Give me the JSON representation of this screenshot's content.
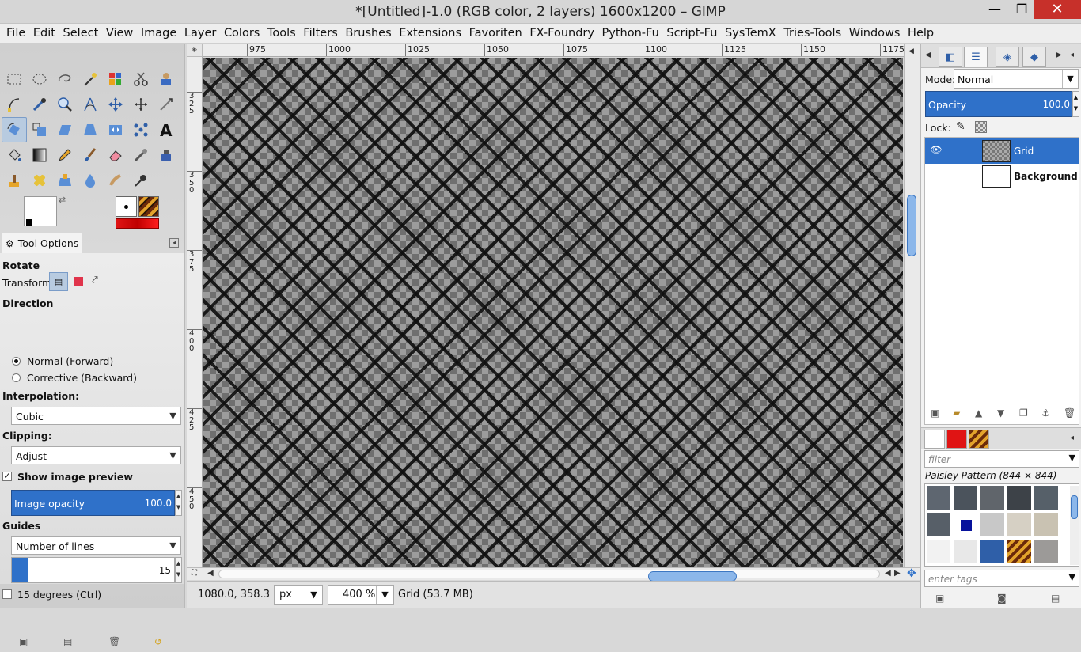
{
  "window": {
    "title": "*[Untitled]-1.0 (RGB color, 2 layers) 1600x1200 – GIMP",
    "minimize": "—",
    "maximize": "❐",
    "close": "✕"
  },
  "menu": [
    "File",
    "Edit",
    "Select",
    "View",
    "Image",
    "Layer",
    "Colors",
    "Tools",
    "Filters",
    "Brushes",
    "Extensions",
    "Favoriten",
    "FX-Foundry",
    "Python-Fu",
    "Script-Fu",
    "SysTemX",
    "Tries-Tools",
    "Windows",
    "Help"
  ],
  "tool_options": {
    "tab_label": "Tool Options",
    "tool_name": "Rotate",
    "transform_label": "Transform:",
    "direction_heading": "Direction",
    "direction_options": [
      "Normal (Forward)",
      "Corrective (Backward)"
    ],
    "direction_selected": "Normal (Forward)",
    "interpolation_label": "Interpolation:",
    "interpolation_value": "Cubic",
    "clipping_label": "Clipping:",
    "clipping_value": "Adjust",
    "show_preview_label": "Show image preview",
    "show_preview_checked": true,
    "image_opacity_label": "Image opacity",
    "image_opacity_value": "100.0",
    "guides_label": "Guides",
    "guides_value": "Number of lines",
    "guide_lines_value": "15",
    "fifteen_degrees_label": "15 degrees  (Ctrl)"
  },
  "ruler_top": [
    "975",
    "1000",
    "1025",
    "1050",
    "1075",
    "1100",
    "1125",
    "1150",
    "1175"
  ],
  "ruler_left": [
    "3\n2\n5",
    "3\n5\n0",
    "3\n7\n5",
    "4\n0\n0",
    "4\n2\n5",
    "4\n5\n0"
  ],
  "statusbar": {
    "coords": "1080.0, 358.3",
    "unit": "px",
    "zoom": "400 %",
    "message": "Grid (53.7 MB)"
  },
  "layers": {
    "mode_label": "Mode:",
    "mode_value": "Normal",
    "opacity_label": "Opacity",
    "opacity_value": "100.0",
    "lock_label": "Lock:",
    "items": [
      {
        "name": "Grid",
        "selected": true,
        "visible": true
      },
      {
        "name": "Background",
        "selected": false,
        "visible": false
      }
    ]
  },
  "patterns": {
    "filter_placeholder": "filter",
    "current_name": "Paisley Pattern (844 × 844)",
    "tags_placeholder": "enter tags"
  },
  "colors": {
    "accent": "#2f71c9",
    "foreground": "#ffffff",
    "background": "#000000",
    "gradient": "#e01414"
  }
}
